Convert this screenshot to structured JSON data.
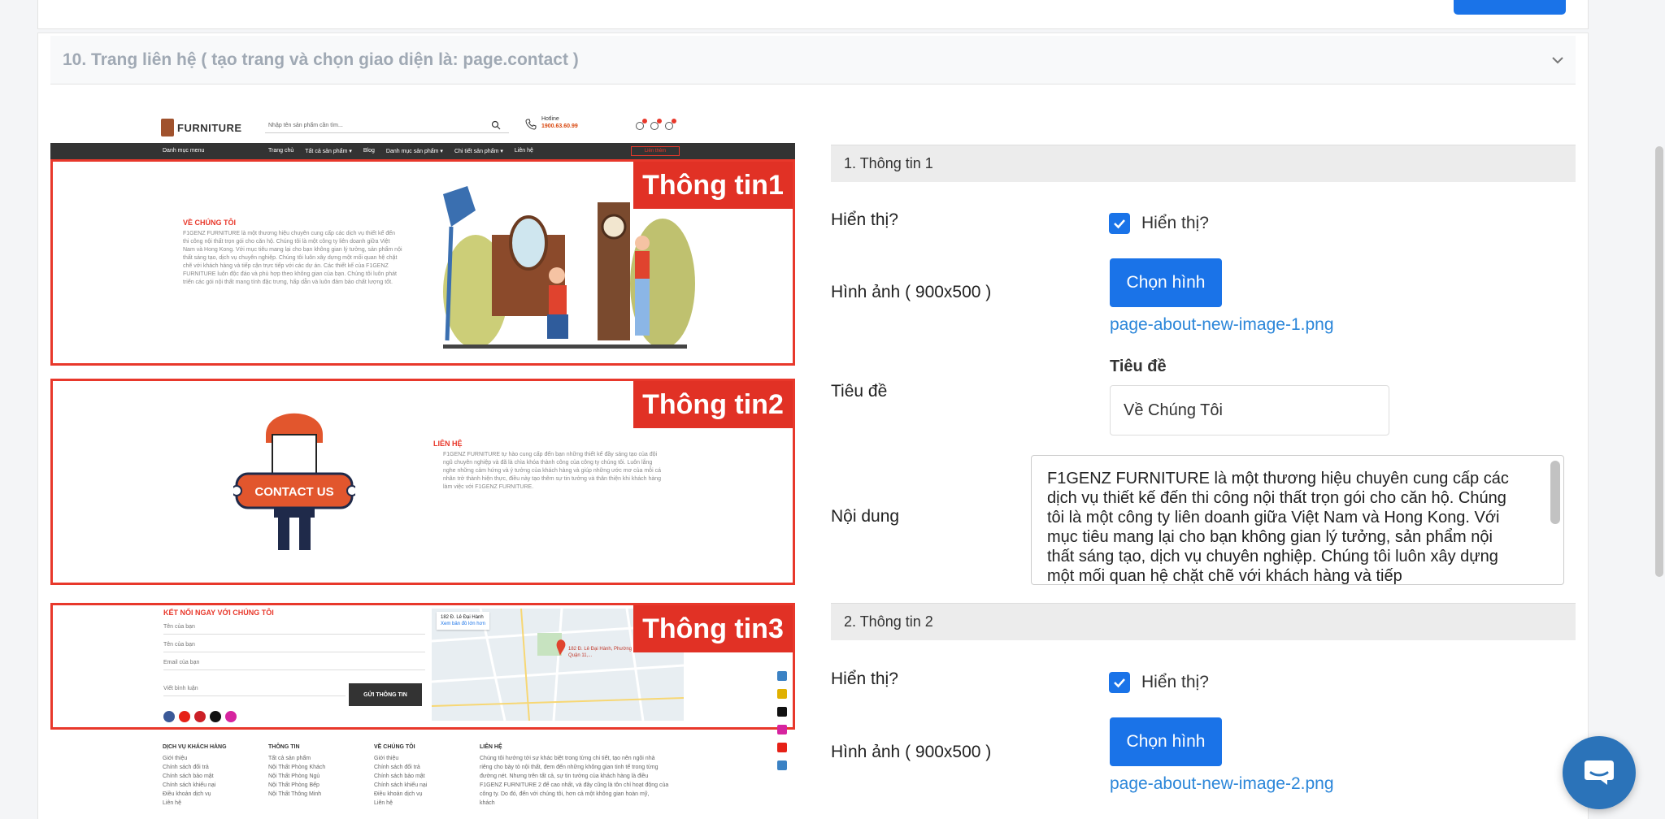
{
  "accordion": {
    "title": "10. Trang liên hệ ( tạo trang và chọn giao diện là: page.contact )"
  },
  "preview": {
    "logo": "FURNITURE",
    "search_placeholder": "Nhập tên sản phẩm cần tìm...",
    "hotline_label": "Hotline",
    "hotline_number": "1900.63.60.99",
    "nav": {
      "menu": "Danh mục menu",
      "links": [
        "Trang chủ",
        "Tất cả sản phẩm ▾",
        "Blog",
        "Danh mục sản phẩm ▾",
        "Chi tiết sản phẩm ▾",
        "Liên hệ"
      ],
      "button": "Liên thêm"
    },
    "badges": [
      "Thông tin1",
      "Thông tin2",
      "Thông tin3"
    ],
    "about": {
      "heading": "VỀ CHÚNG TÔI",
      "text": "F1GENZ FURNITURE là một thương hiệu chuyên cung cấp các dịch vụ thiết kế đến thi công nội thất trọn gói cho căn hộ. Chúng tôi là một công ty liên doanh giữa Việt Nam và Hong Kong. Với mục tiêu mang lại cho bạn không gian lý tưởng, sản phẩm nội thất sáng tạo, dịch vụ chuyên nghiệp. Chúng tôi luôn xây dựng một mối quan hệ chặt chẽ với khách hàng và tiếp cận trực tiếp với các dự án. Các thiết kế của F1GENZ FURNITURE luôn độc đáo và phù hợp theo không gian của bạn. Chúng tôi luôn phát triển các gói nội thất mang tính đặc trưng, hấp dẫn và luôn đảm bảo chất lượng tốt."
    },
    "contact": {
      "sign": "CONTACT US",
      "heading": "LIÊN HỆ",
      "text": "F1GENZ FURNITURE tự hào cung cấp đến bạn những thiết kế đầy sáng tạo của đội ngũ chuyên nghiệp và đã là chìa khóa thành công của công ty chúng tôi. Luôn lắng nghe những cảm hứng và ý tưởng của khách hàng và giúp những ước mơ của mỗi cá nhân trở thành hiện thực, điều này tạo thêm sự tin tưởng và thân thiện khi khách hàng làm việc với F1GENZ FURNITURE."
    },
    "connect": {
      "heading": "KẾT NỐI NGAY VỚI CHÚNG TÔI",
      "fields": [
        "Tên của bạn",
        "Tên của bạn",
        "Email của bạn",
        "Viết bình luận"
      ],
      "button": "GỬI THÔNG TIN",
      "map_title": "182 Đ. Lê Đại Hành",
      "map_link": "Xem bản đồ lớn hơn",
      "map_pin": "182 Đ. Lê Đại Hành, Phường 15, Quận 11,..."
    },
    "footer": [
      {
        "title": "DỊCH VỤ KHÁCH HÀNG",
        "items": [
          "Giới thiệu",
          "Chính sách đổi trả",
          "Chính sách bảo mật",
          "Chính sách khiếu nại",
          "Điều khoản dịch vụ",
          "Liên hệ"
        ]
      },
      {
        "title": "THÔNG TIN",
        "items": [
          "Tất cả sản phẩm",
          "Nội Thất Phòng Khách",
          "Nội Thất Phòng Ngủ",
          "Nội Thất Phòng Bếp",
          "Nội Thất Thông Minh"
        ]
      },
      {
        "title": "VỀ CHÚNG TÔI",
        "items": [
          "Giới thiệu",
          "Chính sách đổi trả",
          "Chính sách bảo mật",
          "Chính sách khiếu nại",
          "Điều khoản dịch vụ",
          "Liên hệ"
        ]
      },
      {
        "title": "LIÊN HỆ",
        "items": [
          "Chúng tôi hướng tới sự khác biệt trong từng chi tiết, tạo nên ngôi nhà",
          "riêng cho bày tỏ nội thất, đem đến những không gian tinh tế trong từng",
          "đường nét. Nhưng trên tất cả, sự tin tưởng của khách hàng là điều",
          "F1GENZ FURNITURE 2 để cao nhất, và đây cũng là tôn chỉ hoạt động của",
          "công ty. Do đó, đến với chúng tôi, hơn cả một không gian hoàn mỹ,",
          "khách"
        ]
      }
    ]
  },
  "form": {
    "section1_title": "1. Thông tin 1",
    "section2_title": "2. Thông tin 2",
    "show_label": "Hiển thị?",
    "checkbox_label": "Hiển thị?",
    "image_label": "Hình ảnh ( 900x500 )",
    "pick_button": "Chọn hình",
    "file1": "page-about-new-image-1.png",
    "file2": "page-about-new-image-2.png",
    "title_row_label": "Tiêu đề",
    "title_field_label": "Tiêu đề",
    "title_value": "Về Chúng Tôi",
    "content_label": "Nội dung",
    "content_value": "F1GENZ FURNITURE là một thương hiệu chuyên cung cấp các dịch vụ thiết kế đến thi công nội thất trọn gói cho căn hộ. Chúng tôi là một công ty liên doanh giữa Việt Nam và Hong Kong. Với mục tiêu mang lại cho bạn không gian lý tưởng, sản phẩm nội thất sáng tạo, dịch vụ chuyên nghiệp. Chúng tôi luôn xây dựng một mối quan hệ chặt chẽ với khách hàng và tiếp"
  },
  "colors": {
    "primary": "#1a73e8",
    "badge": "#e13125",
    "link": "#2b86d9",
    "chat": "#2b73b9"
  }
}
